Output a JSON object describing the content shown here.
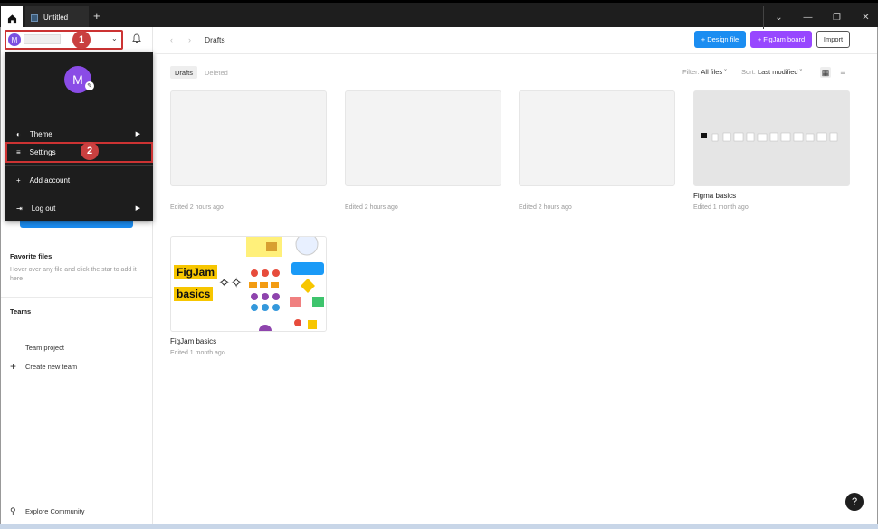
{
  "titlebar": {
    "tab_title": "Untitled",
    "new_tab": "+"
  },
  "account": {
    "avatar_letter": "M"
  },
  "annotations": {
    "step1": "1",
    "step2": "2"
  },
  "menu": {
    "avatar_letter": "M",
    "items": [
      {
        "label": "Theme"
      },
      {
        "label": "Settings"
      },
      {
        "label": "Add account"
      },
      {
        "label": "Log out"
      }
    ]
  },
  "sidebar": {
    "favorites_title": "Favorite files",
    "favorites_hint": "Hover over any file and click the star to add it here",
    "teams_title": "Teams",
    "team_project": "Team project",
    "create_team": "Create new team",
    "explore": "Explore Community"
  },
  "header": {
    "breadcrumb": "Drafts",
    "design_file": "+ Design file",
    "figjam_board": "+ FigJam board",
    "import": "Import"
  },
  "tabs": {
    "drafts": "Drafts",
    "deleted": "Deleted"
  },
  "filters": {
    "filter_label": "Filter:",
    "filter_value": "All files",
    "sort_label": "Sort:",
    "sort_value": "Last modified"
  },
  "files": [
    {
      "title": "",
      "meta": "Edited 2 hours ago"
    },
    {
      "title": "",
      "meta": "Edited 2 hours ago"
    },
    {
      "title": "",
      "meta": "Edited 2 hours ago"
    },
    {
      "title": "Figma basics",
      "meta": "Edited 1 month ago"
    },
    {
      "title": "FigJam basics",
      "meta": "Edited 1 month ago"
    }
  ],
  "figjam_thumb": {
    "line1": "FigJam",
    "line2": "basics"
  },
  "help": "?",
  "colors": {
    "blue": "#1b8df1",
    "purple": "#9747ff",
    "annotation_red": "#c94040",
    "avatar": "#7b4fe0"
  }
}
